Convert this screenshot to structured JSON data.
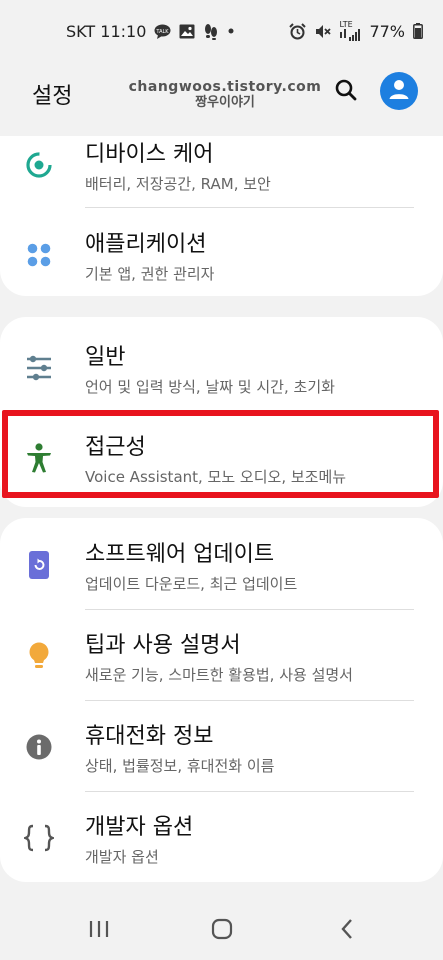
{
  "status_bar": {
    "carrier_time": "SKT 11:10",
    "network": "LTE",
    "battery": "77%",
    "icons": [
      "talk-icon",
      "gallery-icon",
      "feet-icon",
      "dot-icon",
      "alarm-icon",
      "mute-icon",
      "signal-icon",
      "battery-icon"
    ]
  },
  "header": {
    "title": "설정",
    "watermark_line1": "changwoos.tistory.com",
    "watermark_line2": "짱우이야기"
  },
  "groups": [
    {
      "items": [
        {
          "label": "디바이스 케어",
          "sub": "배터리, 저장공간, RAM, 보안",
          "icon": "device-care-icon",
          "color": "#1fa891"
        },
        {
          "label": "애플리케이션",
          "sub": "기본 앱, 권한 관리자",
          "icon": "apps-icon",
          "color": "#5b9ee6"
        }
      ]
    },
    {
      "items": [
        {
          "label": "일반",
          "sub": "언어 및 입력 방식, 날짜 및 시간, 초기화",
          "icon": "sliders-icon",
          "color": "#5f7f8f"
        },
        {
          "label": "접근성",
          "sub": "Voice Assistant, 모노 오디오, 보조메뉴",
          "icon": "accessibility-icon",
          "color": "#2e7d32"
        }
      ]
    },
    {
      "items": [
        {
          "label": "소프트웨어 업데이트",
          "sub": "업데이트 다운로드, 최근 업데이트",
          "icon": "software-update-icon",
          "color": "#6a6fd8"
        },
        {
          "label": "팁과 사용 설명서",
          "sub": "새로운 기능, 스마트한 활용법, 사용 설명서",
          "icon": "lightbulb-icon",
          "color": "#f2a93b"
        },
        {
          "label": "휴대전화 정보",
          "sub": "상태, 법률정보, 휴대전화 이름",
          "icon": "info-icon",
          "color": "#6b6b6b"
        },
        {
          "label": "개발자 옵션",
          "sub": "개발자 옵션",
          "icon": "braces-icon",
          "color": "#555555"
        }
      ]
    }
  ],
  "highlight_color": "#e8141e",
  "accent_color": "#1d7fe0"
}
